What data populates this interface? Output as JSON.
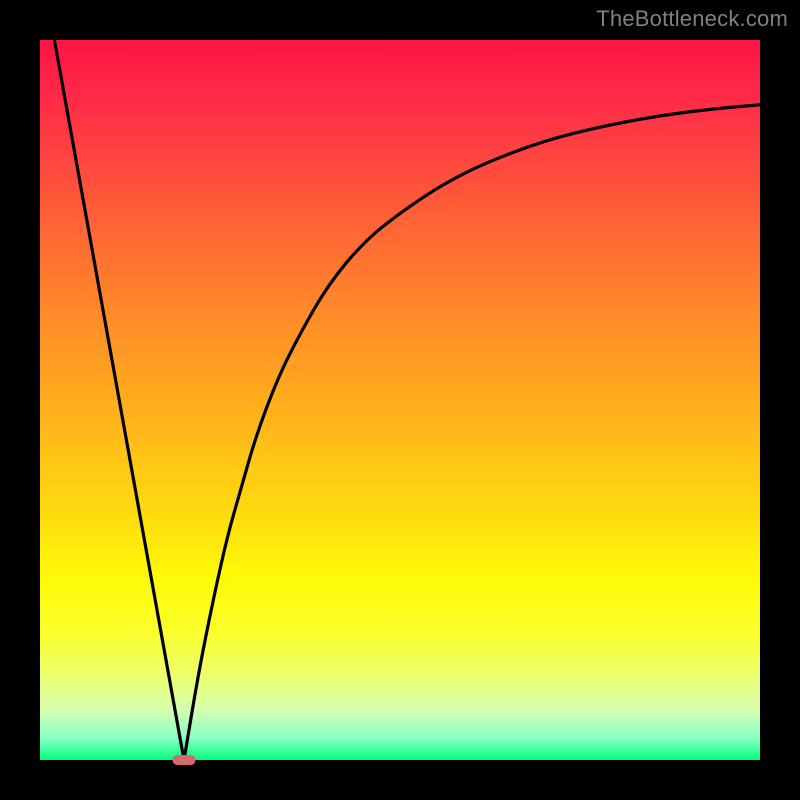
{
  "watermark": "TheBottleneck.com",
  "colors": {
    "frame": "#000000",
    "curve_stroke": "#000000",
    "marker_fill": "#d46a6a",
    "gradient_top": "#ff1444",
    "gradient_bottom": "#00ff7b"
  },
  "chart_data": {
    "type": "line",
    "title": "",
    "xlabel": "",
    "ylabel": "",
    "xlim": [
      0,
      100
    ],
    "ylim": [
      0,
      100
    ],
    "grid": false,
    "legend": false,
    "series": [
      {
        "name": "left-slope",
        "x": [
          2,
          20
        ],
        "y": [
          100,
          0
        ]
      },
      {
        "name": "right-curve",
        "x": [
          20,
          22,
          24,
          26,
          28,
          30,
          33,
          36,
          40,
          45,
          50,
          56,
          62,
          70,
          78,
          86,
          94,
          100
        ],
        "y": [
          0,
          12,
          22,
          31,
          38,
          45,
          53,
          59,
          66,
          72,
          76,
          80,
          83,
          86,
          88,
          89.5,
          90.5,
          91
        ]
      }
    ],
    "marker": {
      "name": "bottleneck-point",
      "x": 20,
      "y": 0,
      "shape": "rounded-bar",
      "width_pct": 3.2,
      "height_pct": 1.4
    }
  }
}
